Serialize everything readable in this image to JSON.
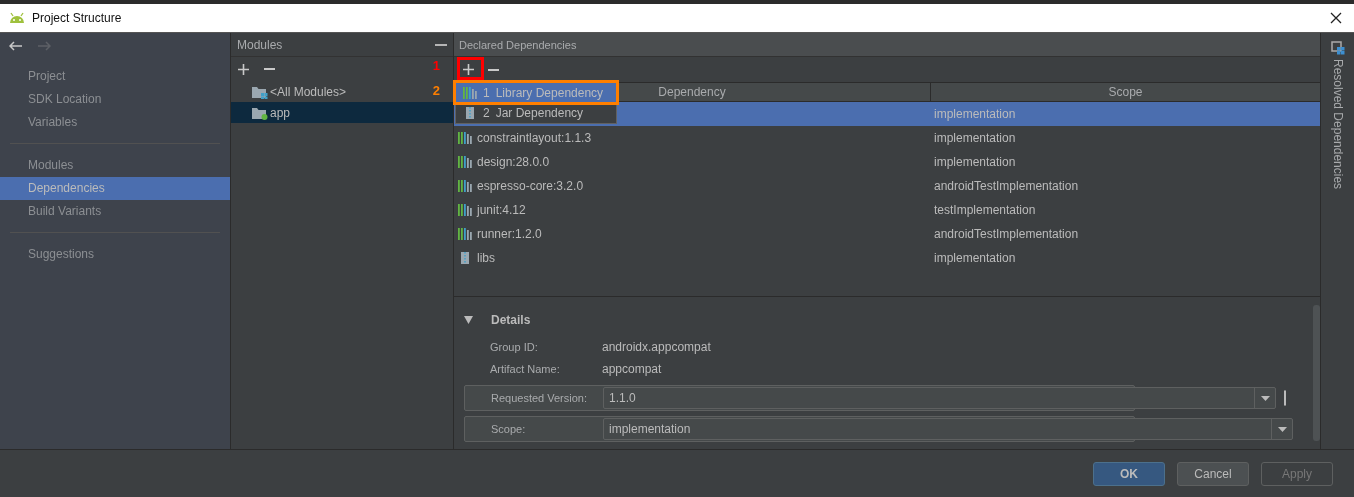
{
  "window": {
    "title": "Project Structure"
  },
  "sidebar": {
    "groups": [
      [
        {
          "label": "Project",
          "selected": false
        },
        {
          "label": "SDK Location",
          "selected": false
        },
        {
          "label": "Variables",
          "selected": false
        }
      ],
      [
        {
          "label": "Modules",
          "selected": false
        },
        {
          "label": "Dependencies",
          "selected": true
        },
        {
          "label": "Build Variants",
          "selected": false
        }
      ],
      [
        {
          "label": "Suggestions",
          "selected": false
        }
      ]
    ]
  },
  "modules": {
    "title": "Modules",
    "items": [
      {
        "label": "<All Modules>",
        "kind": "all",
        "selected": false
      },
      {
        "label": "app",
        "kind": "module",
        "selected": true
      }
    ]
  },
  "annotations": [
    {
      "label": "1",
      "color": "#ff0000"
    },
    {
      "label": "2",
      "color": "#ff7f00"
    }
  ],
  "dependencies": {
    "title": "Declared Dependencies",
    "columns": [
      "Dependency",
      "Scope"
    ],
    "rows": [
      {
        "scope": "implementation",
        "selected": true
      },
      {
        "kind": "library",
        "name": "constraintlayout:1.1.3",
        "scope": "implementation",
        "selected": false
      },
      {
        "kind": "library",
        "name": "design:28.0.0",
        "scope": "implementation",
        "selected": false
      },
      {
        "kind": "library",
        "name": "espresso-core:3.2.0",
        "scope": "androidTestImplementation",
        "selected": false
      },
      {
        "kind": "library",
        "name": "junit:4.12",
        "scope": "testImplementation",
        "selected": false
      },
      {
        "kind": "library",
        "name": "runner:1.2.0",
        "scope": "androidTestImplementation",
        "selected": false
      },
      {
        "kind": "jar",
        "name": "libs",
        "scope": "implementation",
        "selected": false
      }
    ]
  },
  "add_menu": {
    "items": [
      {
        "number": "1",
        "label": "Library Dependency",
        "kind": "library",
        "selected": true
      },
      {
        "number": "2",
        "label": "Jar Dependency",
        "kind": "jar",
        "selected": false
      }
    ]
  },
  "details": {
    "title": "Details",
    "expanded": true,
    "fields": [
      {
        "label": "Group ID:",
        "value": "androidx.appcompat",
        "kind": "text"
      },
      {
        "label": "Artifact Name:",
        "value": "appcompat",
        "kind": "text"
      },
      {
        "label": "Requested Version:",
        "value": "1.1.0",
        "kind": "combo"
      },
      {
        "label": "Scope:",
        "value": "implementation",
        "kind": "combo"
      }
    ]
  },
  "side_tab": {
    "label": "Resolved Dependencies"
  },
  "buttons": [
    {
      "label": "OK",
      "kind": "default",
      "disabled": false
    },
    {
      "label": "Cancel",
      "kind": "normal",
      "disabled": false
    },
    {
      "label": "Apply",
      "kind": "normal",
      "disabled": true
    }
  ]
}
